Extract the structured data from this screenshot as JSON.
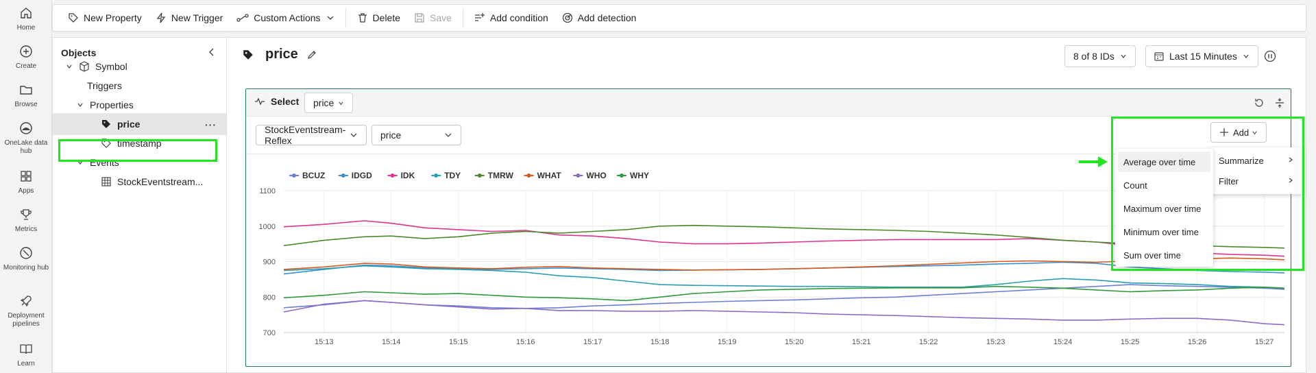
{
  "rail": {
    "items": [
      {
        "label": "Home",
        "icon": "home-icon"
      },
      {
        "label": "Create",
        "icon": "plus-circle-icon"
      },
      {
        "label": "Browse",
        "icon": "folder-icon"
      },
      {
        "label": "OneLake data hub",
        "icon": "onelake-icon"
      },
      {
        "label": "Apps",
        "icon": "apps-icon"
      },
      {
        "label": "Metrics",
        "icon": "trophy-icon"
      },
      {
        "label": "Monitoring hub",
        "icon": "monitoring-icon"
      },
      {
        "label": "Deployment pipelines",
        "icon": "rocket-icon"
      },
      {
        "label": "Learn",
        "icon": "book-icon"
      }
    ]
  },
  "toolbar": {
    "new_property": "New Property",
    "new_trigger": "New Trigger",
    "custom_actions": "Custom Actions",
    "delete": "Delete",
    "save": "Save",
    "add_condition": "Add condition",
    "add_detection": "Add detection"
  },
  "objects": {
    "title": "Objects",
    "tree": {
      "symbol": "Symbol",
      "triggers": "Triggers",
      "properties": "Properties",
      "price": "price",
      "timestamp": "timestamp",
      "events": "Events",
      "stream": "StockEventstream..."
    },
    "more": "···"
  },
  "header": {
    "title": "price",
    "ids": "8 of 8 IDs",
    "time_range": "Last 15 Minutes"
  },
  "card": {
    "select_label": "Select",
    "select_value": "price",
    "source_dropdown": "StockEventstream-Reflex",
    "property_dropdown": "price",
    "add_button": "Add"
  },
  "menu": {
    "items": [
      "Average over time",
      "Count",
      "Maximum over time",
      "Minimum over time",
      "Sum over time"
    ],
    "submenu": [
      "Summarize",
      "Filter"
    ]
  },
  "colors": {
    "accent_green": "#22e622",
    "card_border": "#1e7a66"
  },
  "chart_data": {
    "type": "line",
    "ylim": [
      700,
      1100
    ],
    "yticks": [
      "1100",
      "1000",
      "900",
      "800",
      "700"
    ],
    "xticks": [
      "15:13",
      "15:14",
      "15:15",
      "15:16",
      "15:17",
      "15:18",
      "15:19",
      "15:20",
      "15:21",
      "15:22",
      "15:23",
      "15:24",
      "15:25",
      "15:26",
      "15:27"
    ],
    "x_range": [
      12.4,
      27.3
    ],
    "x": [
      12.4,
      13.0,
      13.6,
      14.0,
      14.5,
      15.0,
      15.5,
      16.0,
      16.5,
      17.0,
      17.5,
      18.0,
      18.5,
      19.0,
      19.5,
      20.0,
      20.5,
      21.0,
      21.5,
      22.0,
      22.5,
      23.0,
      23.5,
      24.0,
      24.5,
      25.0,
      25.5,
      26.0,
      26.5,
      27.0,
      27.3
    ],
    "series": [
      {
        "name": "BCUZ",
        "color": "#6b7fd7",
        "values": [
          770,
          778,
          790,
          785,
          778,
          775,
          770,
          768,
          770,
          775,
          778,
          782,
          785,
          788,
          790,
          792,
          795,
          798,
          800,
          805,
          810,
          815,
          820,
          825,
          830,
          835,
          832,
          830,
          828,
          825,
          822
        ]
      },
      {
        "name": "IDGD",
        "color": "#3a8fd0",
        "values": [
          865,
          878,
          890,
          888,
          882,
          880,
          878,
          880,
          882,
          880,
          878,
          875,
          876,
          877,
          878,
          880,
          882,
          884,
          886,
          888,
          890,
          893,
          895,
          898,
          895,
          885,
          880,
          875,
          872,
          870,
          868
        ]
      },
      {
        "name": "IDK",
        "color": "#e0338f",
        "values": [
          998,
          1005,
          1015,
          1008,
          995,
          990,
          985,
          988,
          975,
          972,
          965,
          955,
          950,
          950,
          952,
          955,
          958,
          960,
          962,
          962,
          962,
          962,
          965,
          960,
          955,
          945,
          935,
          925,
          920,
          918,
          915
        ]
      },
      {
        "name": "TDY",
        "color": "#2a9db0",
        "values": [
          875,
          880,
          888,
          885,
          880,
          878,
          875,
          870,
          860,
          855,
          845,
          835,
          833,
          832,
          831,
          830,
          830,
          829,
          828,
          828,
          828,
          835,
          845,
          852,
          848,
          840,
          838,
          835,
          830,
          828,
          825
        ]
      },
      {
        "name": "TMRW",
        "color": "#4a8a2a",
        "values": [
          945,
          960,
          970,
          972,
          965,
          970,
          980,
          985,
          980,
          985,
          990,
          1000,
          1002,
          1000,
          998,
          995,
          992,
          990,
          988,
          985,
          980,
          975,
          968,
          960,
          955,
          950,
          948,
          945,
          942,
          940,
          938
        ]
      },
      {
        "name": "WHAT",
        "color": "#d95a1e",
        "values": [
          878,
          885,
          895,
          893,
          885,
          882,
          880,
          884,
          886,
          882,
          880,
          878,
          876,
          877,
          878,
          880,
          882,
          885,
          888,
          892,
          896,
          900,
          902,
          900,
          898,
          902,
          905,
          908,
          910,
          908,
          905
        ]
      },
      {
        "name": "WHO",
        "color": "#8c6bc8",
        "values": [
          758,
          780,
          790,
          785,
          778,
          772,
          766,
          768,
          762,
          762,
          760,
          760,
          762,
          760,
          758,
          756,
          752,
          750,
          748,
          745,
          742,
          740,
          738,
          735,
          735,
          738,
          740,
          740,
          735,
          725,
          722
        ]
      },
      {
        "name": "WHY",
        "color": "#2f9a3a",
        "values": [
          798,
          805,
          815,
          812,
          808,
          810,
          805,
          800,
          798,
          795,
          790,
          800,
          810,
          815,
          820,
          822,
          824,
          825,
          826,
          826,
          826,
          830,
          828,
          825,
          820,
          815,
          818,
          820,
          825,
          828,
          825
        ]
      }
    ]
  }
}
